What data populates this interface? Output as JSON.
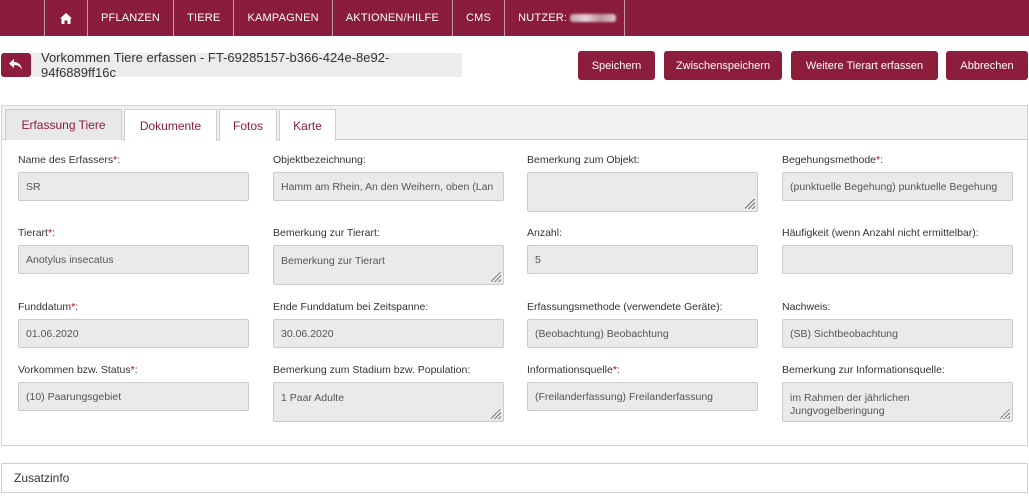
{
  "nav": {
    "items": [
      "PFLANZEN",
      "TIERE",
      "KAMPAGNEN",
      "AKTIONEN/HILFE",
      "CMS"
    ],
    "user_label": "NUTZER:"
  },
  "header": {
    "title": "Vorkommen Tiere erfassen - FT-69285157-b366-424e-8e92-94f6889ff16c",
    "buttons": {
      "save": "Speichern",
      "intermediate_save": "Zwischenspeichern",
      "add_species": "Weitere Tierart erfassen",
      "cancel": "Abbrechen"
    }
  },
  "tabs": [
    "Erfassung Tiere",
    "Dokumente",
    "Fotos",
    "Karte"
  ],
  "form": {
    "name_erfasser": {
      "label": "Name des Erfassers",
      "value": "SR"
    },
    "objektbezeichnung": {
      "label": "Objektbezeichnung:",
      "value": "Hamm am Rhein, An den Weihern, oben (Lan"
    },
    "bemerkung_objekt": {
      "label": "Bemerkung zum Objekt:",
      "value": ""
    },
    "begehungsmethode": {
      "label": "Begehungsmethode",
      "value": "(punktuelle Begehung) punktuelle Begehung"
    },
    "tierart": {
      "label": "Tierart",
      "value": "Anotylus insecatus"
    },
    "bemerkung_tierart": {
      "label": "Bemerkung zur Tierart:",
      "value": "Bemerkung zur Tierart"
    },
    "anzahl": {
      "label": "Anzahl:",
      "value": "5"
    },
    "haeufigkeit": {
      "label": "Häufigkeit (wenn Anzahl nicht ermittelbar):",
      "value": ""
    },
    "funddatum": {
      "label": "Funddatum",
      "value": "01.06.2020"
    },
    "ende_funddatum": {
      "label": "Ende Funddatum bei Zeitspanne:",
      "value": "30.06.2020"
    },
    "erfassungsmethode": {
      "label": "Erfassungsmethode (verwendete Geräte):",
      "value": "(Beobachtung) Beobachtung"
    },
    "nachweis": {
      "label": "Nachweis:",
      "value": "(SB) Sichtbeobachtung"
    },
    "status": {
      "label": "Vorkommen bzw. Status",
      "value": "(10) Paarungsgebiet"
    },
    "bemerkung_stadium": {
      "label": "Bemerkung zum Stadium bzw. Population:",
      "value": "1 Paar Adulte"
    },
    "informationsquelle": {
      "label": "Informationsquelle",
      "value": "(Freilanderfassung) Freilanderfassung"
    },
    "bemerkung_info": {
      "label": "Bemerkung zur Informationsquelle:",
      "value": "im Rahmen der jährlichen Jungvogelberingung"
    }
  },
  "zusatzinfo": {
    "label": "Zusatzinfo"
  },
  "colors": {
    "brand": "#8c1d3c",
    "field_bg": "#eaeaea",
    "required": "#cc0000"
  },
  "icons": {
    "home": "home-icon",
    "back": "back-arrow-icon",
    "resize": "resize-grip-icon"
  }
}
